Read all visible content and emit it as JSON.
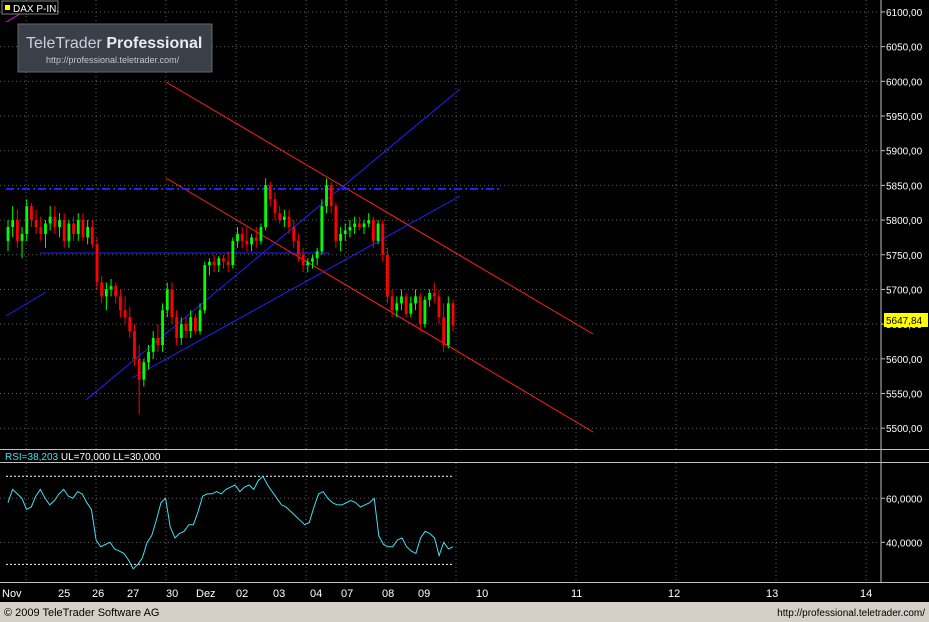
{
  "header": {
    "symbol": "DAX P-IN.",
    "watermark_title_1": "TeleTrader ",
    "watermark_title_2": "Professional",
    "watermark_url": "http://professional.teletrader.com/"
  },
  "price_panel": {
    "y_ticks": [
      "6100,00",
      "6050,00",
      "6000,00",
      "5950,00",
      "5900,00",
      "5850,00",
      "5800,00",
      "5750,00",
      "5700,00",
      "5650,00",
      "5600,00",
      "5550,00",
      "5500,00"
    ],
    "last_price": "5647,84"
  },
  "rsi_panel": {
    "label_a": "RSI=38,203",
    "label_b": " UL=70,000 LL=30,000",
    "y_ticks": [
      "60,0000",
      "40,0000"
    ]
  },
  "x_axis": {
    "labels": [
      "Nov",
      "25",
      "26",
      "27",
      "30",
      "Dez",
      "02",
      "03",
      "04",
      "07",
      "08",
      "09",
      "10",
      "11",
      "12",
      "13",
      "14"
    ]
  },
  "footer": {
    "copyright": "© 2009 TeleTrader Software AG",
    "url": "http://professional.teletrader.com/"
  },
  "colors": {
    "background": "#000000",
    "up_candle": "#00ff00",
    "down_candle": "#ff0000",
    "trend_red": "#ff2020",
    "trend_blue": "#2020ff",
    "rsi_line": "#40e0f0"
  },
  "chart_data": [
    {
      "type": "candlestick",
      "title": "DAX P-IN.",
      "y_range": [
        5470,
        6110
      ],
      "x_range": [
        "Nov 24",
        "Dec 14"
      ],
      "last_value": 5647.84,
      "candles": [
        [
          5770,
          5800,
          5755,
          5790
        ],
        [
          5790,
          5820,
          5775,
          5800
        ],
        [
          5800,
          5815,
          5760,
          5770
        ],
        [
          5770,
          5790,
          5745,
          5780
        ],
        [
          5780,
          5830,
          5770,
          5820
        ],
        [
          5820,
          5825,
          5790,
          5800
        ],
        [
          5800,
          5815,
          5780,
          5790
        ],
        [
          5790,
          5805,
          5770,
          5780
        ],
        [
          5780,
          5800,
          5760,
          5795
        ],
        [
          5795,
          5820,
          5785,
          5805
        ],
        [
          5805,
          5820,
          5780,
          5790
        ],
        [
          5790,
          5810,
          5775,
          5800
        ],
        [
          5800,
          5810,
          5760,
          5770
        ],
        [
          5770,
          5800,
          5760,
          5795
        ],
        [
          5795,
          5805,
          5770,
          5780
        ],
        [
          5780,
          5810,
          5770,
          5800
        ],
        [
          5800,
          5810,
          5770,
          5775
        ],
        [
          5775,
          5800,
          5765,
          5790
        ],
        [
          5790,
          5800,
          5760,
          5765
        ],
        [
          5765,
          5775,
          5700,
          5710
        ],
        [
          5710,
          5720,
          5680,
          5690
        ],
        [
          5690,
          5710,
          5670,
          5700
        ],
        [
          5700,
          5715,
          5690,
          5705
        ],
        [
          5705,
          5710,
          5680,
          5690
        ],
        [
          5690,
          5700,
          5660,
          5670
        ],
        [
          5670,
          5690,
          5650,
          5660
        ],
        [
          5660,
          5675,
          5630,
          5640
        ],
        [
          5640,
          5650,
          5590,
          5600
        ],
        [
          5600,
          5620,
          5520,
          5570
        ],
        [
          5570,
          5600,
          5560,
          5595
        ],
        [
          5595,
          5620,
          5585,
          5610
        ],
        [
          5610,
          5640,
          5600,
          5630
        ],
        [
          5630,
          5650,
          5610,
          5620
        ],
        [
          5620,
          5680,
          5610,
          5670
        ],
        [
          5670,
          5710,
          5660,
          5700
        ],
        [
          5700,
          5710,
          5650,
          5660
        ],
        [
          5660,
          5670,
          5620,
          5630
        ],
        [
          5630,
          5660,
          5620,
          5650
        ],
        [
          5650,
          5660,
          5630,
          5640
        ],
        [
          5640,
          5670,
          5630,
          5660
        ],
        [
          5660,
          5665,
          5635,
          5640
        ],
        [
          5640,
          5680,
          5635,
          5670
        ],
        [
          5670,
          5740,
          5665,
          5735
        ],
        [
          5735,
          5745,
          5720,
          5740
        ],
        [
          5740,
          5750,
          5725,
          5735
        ],
        [
          5735,
          5748,
          5725,
          5745
        ],
        [
          5745,
          5750,
          5730,
          5740
        ],
        [
          5740,
          5755,
          5725,
          5735
        ],
        [
          5735,
          5775,
          5730,
          5770
        ],
        [
          5770,
          5790,
          5760,
          5780
        ],
        [
          5780,
          5790,
          5760,
          5770
        ],
        [
          5770,
          5790,
          5755,
          5765
        ],
        [
          5765,
          5780,
          5755,
          5775
        ],
        [
          5775,
          5790,
          5760,
          5770
        ],
        [
          5770,
          5795,
          5765,
          5790
        ],
        [
          5790,
          5860,
          5785,
          5850
        ],
        [
          5850,
          5855,
          5820,
          5830
        ],
        [
          5830,
          5840,
          5800,
          5810
        ],
        [
          5810,
          5820,
          5795,
          5800
        ],
        [
          5800,
          5815,
          5790,
          5805
        ],
        [
          5805,
          5815,
          5780,
          5790
        ],
        [
          5790,
          5800,
          5760,
          5770
        ],
        [
          5770,
          5780,
          5740,
          5750
        ],
        [
          5750,
          5760,
          5725,
          5735
        ],
        [
          5735,
          5745,
          5725,
          5740
        ],
        [
          5740,
          5750,
          5730,
          5745
        ],
        [
          5745,
          5760,
          5735,
          5755
        ],
        [
          5755,
          5830,
          5750,
          5820
        ],
        [
          5820,
          5860,
          5810,
          5850
        ],
        [
          5850,
          5855,
          5810,
          5820
        ],
        [
          5820,
          5825,
          5760,
          5770
        ],
        [
          5770,
          5790,
          5755,
          5780
        ],
        [
          5780,
          5795,
          5770,
          5785
        ],
        [
          5785,
          5800,
          5775,
          5790
        ],
        [
          5790,
          5805,
          5780,
          5795
        ],
        [
          5795,
          5805,
          5785,
          5790
        ],
        [
          5790,
          5800,
          5780,
          5795
        ],
        [
          5795,
          5810,
          5790,
          5800
        ],
        [
          5800,
          5805,
          5760,
          5770
        ],
        [
          5770,
          5800,
          5765,
          5795
        ],
        [
          5795,
          5800,
          5740,
          5750
        ],
        [
          5750,
          5760,
          5680,
          5690
        ],
        [
          5690,
          5700,
          5660,
          5670
        ],
        [
          5670,
          5690,
          5660,
          5680
        ],
        [
          5680,
          5700,
          5670,
          5690
        ],
        [
          5690,
          5695,
          5660,
          5665
        ],
        [
          5665,
          5690,
          5660,
          5680
        ],
        [
          5680,
          5700,
          5670,
          5690
        ],
        [
          5690,
          5695,
          5640,
          5650
        ],
        [
          5650,
          5690,
          5645,
          5685
        ],
        [
          5685,
          5700,
          5675,
          5695
        ],
        [
          5695,
          5710,
          5680,
          5690
        ],
        [
          5690,
          5700,
          5650,
          5660
        ],
        [
          5660,
          5680,
          5610,
          5620
        ],
        [
          5620,
          5690,
          5615,
          5680
        ],
        [
          5680,
          5685,
          5640,
          5648
        ]
      ]
    },
    {
      "type": "line",
      "title": "RSI",
      "y_range": [
        22,
        76
      ],
      "upper_limit": 70,
      "lower_limit": 30,
      "last_value": 38.203,
      "values": [
        58,
        64,
        62,
        60,
        55,
        56,
        61,
        64,
        60,
        57,
        59,
        62,
        64,
        61,
        60,
        63,
        62,
        58,
        55,
        41,
        38,
        39,
        40,
        37,
        36,
        35,
        32,
        28,
        30,
        33,
        40,
        43,
        50,
        58,
        60,
        47,
        42,
        44,
        45,
        48,
        48,
        54,
        61,
        62,
        62,
        63,
        62,
        64,
        65,
        66,
        63,
        65,
        66,
        64,
        68,
        70,
        66,
        63,
        60,
        57,
        56,
        54,
        52,
        50,
        48,
        49,
        56,
        62,
        63,
        60,
        58,
        57,
        57,
        58,
        59,
        58,
        56,
        57,
        58,
        60,
        43,
        39,
        38,
        38,
        41,
        42,
        38,
        36,
        35,
        42,
        45,
        44,
        42,
        34,
        40,
        37,
        38
      ]
    }
  ]
}
